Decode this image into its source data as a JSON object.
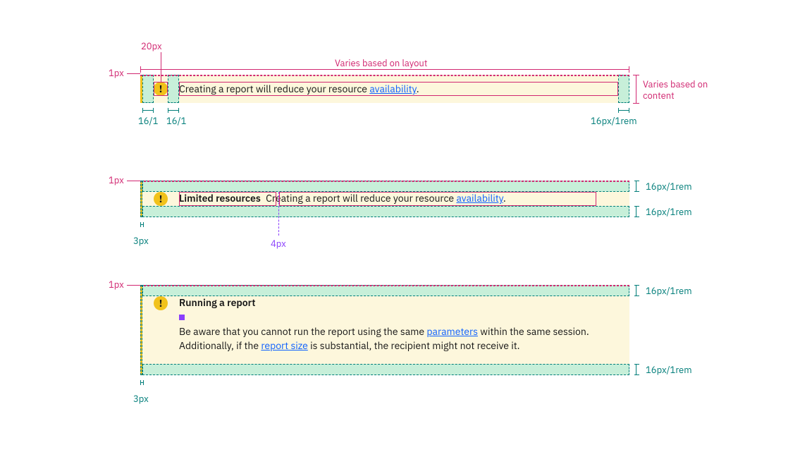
{
  "dims": {
    "icon_label": "20px",
    "border_label": "1px",
    "varies_layout": "Varies based on layout",
    "varies_content": "Varies based on content",
    "pad_lr_1": "16/1",
    "pad_lr_2": "16/1",
    "pad_lr_3": "16px/1rem",
    "leftbar_label": "3px",
    "title_gap_label": "4px",
    "vpad_label": "16px/1rem"
  },
  "notif1": {
    "body_pre": "Creating a report will reduce your resource ",
    "link": "availability",
    "body_post": "."
  },
  "notif2": {
    "title": "Limited resources",
    "body_pre": "Creating a report will reduce your resource ",
    "link": "availability",
    "body_post": "."
  },
  "notif3": {
    "title": "Running a report",
    "body_p1a": "Be aware that you cannot run the report using the same ",
    "link1": "parameters",
    "body_p1b": " within the same session. Additionally, if the ",
    "link2": "report size",
    "body_p1c": " is substantial, the recipient might not receive it."
  }
}
